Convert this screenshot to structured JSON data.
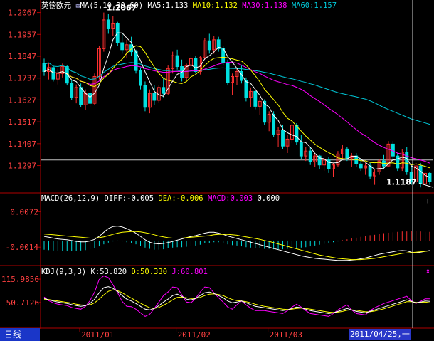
{
  "header": {
    "symbol": "英镑欧元",
    "ma_label": "MA(5,10,30,60)",
    "ma5": "MA5:1.133",
    "ma10": "MA10:1.132",
    "ma30": "MA30:1.138",
    "ma60": "MA60:1.157"
  },
  "macd_header": {
    "label": "MACD(26,12,9)",
    "diff": "DIFF:-0.005",
    "dea": "DEA:-0.006",
    "macd": "MACD:0.003",
    "extra": "0.000"
  },
  "kdj_header": {
    "label": "KDJ(9,3,3)",
    "k": "K:53.820",
    "d": "D:50.330",
    "j": "J:60.801"
  },
  "bottom": {
    "period_tab": "日线",
    "cursor_date": "2011/04/25,一"
  },
  "colors": {
    "up": "#ff3030",
    "down": "#00e0e0",
    "ma5": "#ffffff",
    "ma10": "#ffff00",
    "ma30": "#ff00ff",
    "ma60": "#00c8d8",
    "axis": "#b00000",
    "grid": "#800000",
    "text_red": "#ff4040"
  },
  "chart_data": [
    {
      "type": "candlestick",
      "title": "英镑欧元",
      "y_ticks": [
        "1.2067",
        "1.1957",
        "1.1847",
        "1.1737",
        "1.1627",
        "1.1517",
        "1.1407",
        "1.1297"
      ],
      "ylim": [
        1.117,
        1.2087
      ],
      "annotations": [
        {
          "text": "1.2067",
          "index": 13,
          "value": 1.2067
        },
        {
          "text": "1.1187",
          "index": 82,
          "value": 1.1187
        }
      ],
      "reference_line": 1.1325,
      "x_labels": [
        {
          "text": "2011/01",
          "index": 9
        },
        {
          "text": "2011/02",
          "index": 30
        },
        {
          "text": "2011/03",
          "index": 50
        }
      ],
      "candles": [
        [
          1.1812,
          1.1835,
          1.1748,
          1.177
        ],
        [
          1.177,
          1.1815,
          1.173,
          1.179
        ],
        [
          1.179,
          1.18,
          1.172,
          1.1732
        ],
        [
          1.1732,
          1.1785,
          1.1705,
          1.176
        ],
        [
          1.176,
          1.181,
          1.174,
          1.1795
        ],
        [
          1.1795,
          1.18,
          1.17,
          1.1712
        ],
        [
          1.1712,
          1.1725,
          1.1625,
          1.164
        ],
        [
          1.164,
          1.1705,
          1.161,
          1.169
        ],
        [
          1.169,
          1.171,
          1.159,
          1.1602
        ],
        [
          1.1602,
          1.168,
          1.1575,
          1.166
        ],
        [
          1.166,
          1.169,
          1.159,
          1.161
        ],
        [
          1.161,
          1.176,
          1.16,
          1.1745
        ],
        [
          1.1745,
          1.19,
          1.173,
          1.1885
        ],
        [
          1.1885,
          1.2067,
          1.187,
          1.203
        ],
        [
          1.203,
          1.206,
          1.196,
          1.1985
        ],
        [
          1.1985,
          1.205,
          1.195,
          1.201
        ],
        [
          1.201,
          1.202,
          1.19,
          1.1915
        ],
        [
          1.1915,
          1.196,
          1.186,
          1.188
        ],
        [
          1.188,
          1.193,
          1.184,
          1.1905
        ],
        [
          1.1905,
          1.1945,
          1.185,
          1.187
        ],
        [
          1.187,
          1.188,
          1.176,
          1.1775
        ],
        [
          1.1775,
          1.179,
          1.168,
          1.17
        ],
        [
          1.17,
          1.172,
          1.157,
          1.159
        ],
        [
          1.159,
          1.168,
          1.156,
          1.166
        ],
        [
          1.166,
          1.17,
          1.16,
          1.1625
        ],
        [
          1.1625,
          1.17,
          1.1615,
          1.169
        ],
        [
          1.169,
          1.174,
          1.164,
          1.166
        ],
        [
          1.166,
          1.18,
          1.165,
          1.1785
        ],
        [
          1.1785,
          1.187,
          1.176,
          1.185
        ],
        [
          1.185,
          1.188,
          1.178,
          1.1795
        ],
        [
          1.1795,
          1.183,
          1.172,
          1.174
        ],
        [
          1.174,
          1.181,
          1.1725,
          1.18
        ],
        [
          1.18,
          1.186,
          1.177,
          1.1835
        ],
        [
          1.1835,
          1.185,
          1.176,
          1.177
        ],
        [
          1.177,
          1.185,
          1.1755,
          1.184
        ],
        [
          1.184,
          1.194,
          1.183,
          1.1925
        ],
        [
          1.1925,
          1.196,
          1.186,
          1.188
        ],
        [
          1.188,
          1.195,
          1.186,
          1.193
        ],
        [
          1.193,
          1.1945,
          1.187,
          1.1885
        ],
        [
          1.1885,
          1.19,
          1.18,
          1.1815
        ],
        [
          1.1815,
          1.183,
          1.17,
          1.1715
        ],
        [
          1.1715,
          1.176,
          1.165,
          1.1745
        ],
        [
          1.1745,
          1.179,
          1.17,
          1.177
        ],
        [
          1.177,
          1.18,
          1.171,
          1.1725
        ],
        [
          1.1725,
          1.174,
          1.162,
          1.164
        ],
        [
          1.164,
          1.169,
          1.159,
          1.167
        ],
        [
          1.167,
          1.168,
          1.158,
          1.1595
        ],
        [
          1.1595,
          1.164,
          1.155,
          1.162
        ],
        [
          1.162,
          1.163,
          1.15,
          1.1515
        ],
        [
          1.1515,
          1.157,
          1.147,
          1.1555
        ],
        [
          1.1555,
          1.157,
          1.144,
          1.1455
        ],
        [
          1.1455,
          1.149,
          1.139,
          1.1475
        ],
        [
          1.1475,
          1.15,
          1.138,
          1.1395
        ],
        [
          1.1395,
          1.145,
          1.136,
          1.143
        ],
        [
          1.143,
          1.152,
          1.141,
          1.15
        ],
        [
          1.15,
          1.151,
          1.14,
          1.1415
        ],
        [
          1.1415,
          1.145,
          1.133,
          1.1345
        ],
        [
          1.1345,
          1.139,
          1.132,
          1.137
        ],
        [
          1.137,
          1.139,
          1.13,
          1.1315
        ],
        [
          1.1315,
          1.136,
          1.129,
          1.1345
        ],
        [
          1.1345,
          1.135,
          1.128,
          1.13
        ],
        [
          1.13,
          1.133,
          1.127,
          1.1325
        ],
        [
          1.1325,
          1.134,
          1.126,
          1.128
        ],
        [
          1.128,
          1.131,
          1.124,
          1.13
        ],
        [
          1.13,
          1.137,
          1.129,
          1.1355
        ],
        [
          1.1355,
          1.14,
          1.133,
          1.138
        ],
        [
          1.138,
          1.139,
          1.132,
          1.1335
        ],
        [
          1.1335,
          1.136,
          1.129,
          1.1345
        ],
        [
          1.1345,
          1.136,
          1.129,
          1.1305
        ],
        [
          1.1305,
          1.133,
          1.127,
          1.1285
        ],
        [
          1.1285,
          1.131,
          1.125,
          1.1295
        ],
        [
          1.1295,
          1.131,
          1.123,
          1.1245
        ],
        [
          1.1245,
          1.128,
          1.12,
          1.1265
        ],
        [
          1.1265,
          1.133,
          1.125,
          1.132
        ],
        [
          1.132,
          1.135,
          1.128,
          1.1295
        ],
        [
          1.1295,
          1.142,
          1.129,
          1.1405
        ],
        [
          1.1405,
          1.142,
          1.133,
          1.1345
        ],
        [
          1.1345,
          1.136,
          1.127,
          1.1285
        ],
        [
          1.1285,
          1.138,
          1.127,
          1.1365
        ],
        [
          1.1365,
          1.139,
          1.125,
          1.1265
        ],
        [
          1.1265,
          1.13,
          1.12,
          1.1215
        ],
        [
          1.1215,
          1.131,
          1.1205,
          1.1295
        ],
        [
          1.1295,
          1.131,
          1.1187,
          1.1205
        ],
        [
          1.1205,
          1.127,
          1.1195,
          1.1258
        ],
        [
          1.1258,
          1.1265,
          1.12,
          1.1215
        ]
      ]
    },
    {
      "type": "macd",
      "y_ticks": [
        "0.0072",
        "-0.0014"
      ],
      "ylim": [
        -0.0055,
        0.0095
      ],
      "hist": [
        -0.0022,
        -0.0023,
        -0.0024,
        -0.0025,
        -0.0025,
        -0.0026,
        -0.0026,
        -0.0025,
        -0.0024,
        -0.0023,
        -0.0021,
        -0.0018,
        -0.0014,
        -0.0009,
        -0.0005,
        -0.0002,
        -0.0001,
        -0.0002,
        -0.0004,
        -0.0006,
        -0.0009,
        -0.0013,
        -0.0017,
        -0.002,
        -0.0022,
        -0.0022,
        -0.0021,
        -0.0019,
        -0.0017,
        -0.0016,
        -0.0016,
        -0.0015,
        -0.0013,
        -0.0012,
        -0.001,
        -0.0007,
        -0.0006,
        -0.0004,
        -0.0004,
        -0.0006,
        -0.0009,
        -0.0011,
        -0.0012,
        -0.0014,
        -0.0016,
        -0.0017,
        -0.0018,
        -0.0019,
        -0.002,
        -0.002,
        -0.0021,
        -0.0021,
        -0.0021,
        -0.002,
        -0.0019,
        -0.0018,
        -0.0017,
        -0.0016,
        -0.0014,
        -0.0012,
        -0.001,
        -0.0008,
        -0.0006,
        -0.0004,
        -0.0002,
        0.0001,
        0.0003,
        0.0005,
        0.0007,
        0.0009,
        0.0011,
        0.0013,
        0.0014,
        0.0016,
        0.0018,
        0.0019,
        0.002,
        0.0021,
        0.0022,
        0.0022,
        0.0023,
        0.0023,
        0.0022,
        0.0021,
        0.0021
      ],
      "diff": [
        0.0012,
        0.001,
        0.0008,
        0.0006,
        0.0005,
        0.0004,
        0.0002,
        0.0,
        -0.0001,
        -0.0001,
        0.0001,
        0.0005,
        0.0012,
        0.0022,
        0.0031,
        0.0036,
        0.0037,
        0.0035,
        0.0031,
        0.0026,
        0.002,
        0.0012,
        0.0004,
        -0.0002,
        -0.0005,
        -0.0006,
        -0.0005,
        -0.0003,
        0.0,
        0.0003,
        0.0006,
        0.0009,
        0.0012,
        0.0014,
        0.0017,
        0.002,
        0.0022,
        0.0022,
        0.002,
        0.0017,
        0.0013,
        0.001,
        0.0007,
        0.0004,
        0.0001,
        -0.0002,
        -0.0005,
        -0.0008,
        -0.0011,
        -0.0014,
        -0.0017,
        -0.002,
        -0.0023,
        -0.0026,
        -0.0029,
        -0.0032,
        -0.0035,
        -0.0037,
        -0.0039,
        -0.0041,
        -0.0042,
        -0.0043,
        -0.0044,
        -0.0045,
        -0.0046,
        -0.0046,
        -0.0046,
        -0.0045,
        -0.0044,
        -0.0042,
        -0.004,
        -0.0037,
        -0.0034,
        -0.0031,
        -0.0029,
        -0.0027,
        -0.0025,
        -0.0023,
        -0.0022,
        -0.0023,
        -0.0026,
        -0.0028,
        -0.0026,
        -0.0024,
        -0.0022
      ],
      "dea": [
        0.0018,
        0.0017,
        0.0016,
        0.0015,
        0.0014,
        0.0013,
        0.0012,
        0.0011,
        0.001,
        0.0009,
        0.0008,
        0.0008,
        0.0009,
        0.0011,
        0.0014,
        0.0017,
        0.002,
        0.0022,
        0.0023,
        0.0024,
        0.0024,
        0.0023,
        0.0021,
        0.0019,
        0.0016,
        0.0013,
        0.0011,
        0.0009,
        0.0008,
        0.0008,
        0.0008,
        0.0009,
        0.001,
        0.0011,
        0.0012,
        0.0013,
        0.0014,
        0.0016,
        0.0017,
        0.0017,
        0.0017,
        0.0016,
        0.0015,
        0.0013,
        0.0011,
        0.0009,
        0.0007,
        0.0005,
        0.0002,
        0.0,
        -0.0003,
        -0.0006,
        -0.0009,
        -0.0012,
        -0.0015,
        -0.0018,
        -0.0021,
        -0.0024,
        -0.0027,
        -0.003,
        -0.0033,
        -0.0035,
        -0.0037,
        -0.0039,
        -0.0041,
        -0.0042,
        -0.0043,
        -0.0044,
        -0.0044,
        -0.0044,
        -0.0043,
        -0.0042,
        -0.0041,
        -0.0039,
        -0.0037,
        -0.0035,
        -0.0033,
        -0.0031,
        -0.0029,
        -0.0028,
        -0.0027,
        -0.0026,
        -0.0025,
        -0.0024,
        -0.0023
      ]
    },
    {
      "type": "kdj",
      "y_ticks": [
        "115.9856",
        "50.7126"
      ],
      "ylim": [
        -15,
        128
      ],
      "k": [
        62,
        58,
        55,
        52,
        50,
        48,
        45,
        42,
        40,
        42,
        48,
        60,
        78,
        92,
        95,
        90,
        82,
        70,
        60,
        55,
        48,
        40,
        32,
        30,
        34,
        42,
        52,
        60,
        70,
        74,
        68,
        60,
        58,
        62,
        70,
        78,
        80,
        76,
        70,
        64,
        55,
        50,
        52,
        55,
        50,
        45,
        40,
        38,
        36,
        34,
        32,
        30,
        28,
        30,
        34,
        38,
        36,
        32,
        28,
        26,
        24,
        22,
        20,
        22,
        26,
        30,
        34,
        30,
        26,
        24,
        22,
        26,
        30,
        34,
        38,
        42,
        46,
        50,
        54,
        58,
        54,
        50,
        52,
        55,
        54
      ],
      "d": [
        60,
        59,
        57,
        55,
        53,
        51,
        49,
        46,
        44,
        43,
        44,
        50,
        60,
        72,
        82,
        86,
        84,
        78,
        70,
        63,
        56,
        49,
        42,
        36,
        34,
        37,
        43,
        50,
        58,
        65,
        66,
        64,
        62,
        62,
        65,
        70,
        74,
        75,
        73,
        70,
        64,
        59,
        56,
        55,
        53,
        50,
        46,
        43,
        40,
        38,
        36,
        34,
        32,
        31,
        32,
        34,
        35,
        34,
        32,
        30,
        28,
        26,
        24,
        23,
        24,
        26,
        29,
        30,
        29,
        27,
        25,
        25,
        27,
        30,
        33,
        37,
        41,
        45,
        49,
        53,
        53,
        51,
        51,
        52,
        50
      ],
      "j": [
        66,
        56,
        50,
        46,
        44,
        42,
        37,
        34,
        32,
        40,
        56,
        80,
        115,
        125,
        120,
        100,
        78,
        54,
        40,
        39,
        32,
        22,
        12,
        18,
        34,
        52,
        70,
        80,
        94,
        92,
        72,
        52,
        50,
        62,
        80,
        94,
        92,
        78,
        64,
        52,
        38,
        32,
        44,
        55,
        44,
        35,
        28,
        28,
        28,
        26,
        24,
        22,
        20,
        28,
        38,
        46,
        38,
        28,
        20,
        18,
        16,
        14,
        12,
        20,
        30,
        38,
        44,
        30,
        20,
        18,
        16,
        28,
        36,
        42,
        48,
        52,
        56,
        60,
        64,
        68,
        56,
        48,
        54,
        61,
        61
      ]
    }
  ]
}
